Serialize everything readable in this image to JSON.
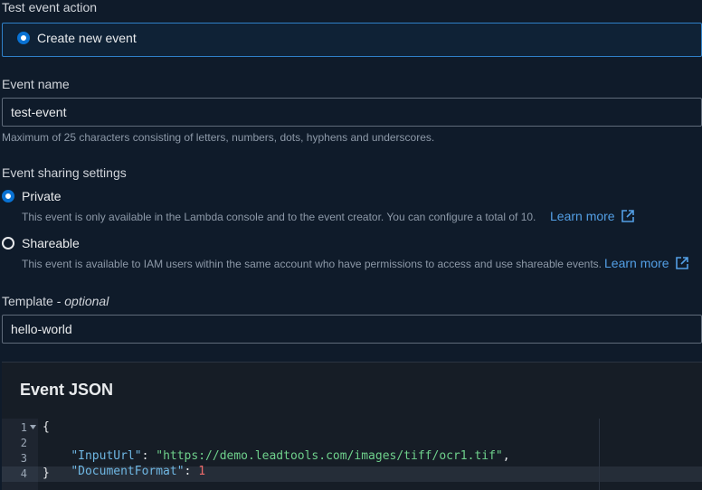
{
  "test_event_action": {
    "label": "Test event action",
    "option": "Create new event"
  },
  "event_name": {
    "label": "Event name",
    "value": "test-event",
    "help": "Maximum of 25 characters consisting of letters, numbers, dots, hyphens and underscores."
  },
  "sharing": {
    "label": "Event sharing settings",
    "private": {
      "label": "Private",
      "description": "This event is only available in the Lambda console and to the event creator. You can configure a total of 10.",
      "link": "Learn more"
    },
    "shareable": {
      "label": "Shareable",
      "description": "This event is available to IAM users within the same account who have permissions to access and use shareable events.",
      "link": "Learn more"
    }
  },
  "template": {
    "label": "Template",
    "optional": "optional",
    "value": "hello-world"
  },
  "event_json": {
    "title": "Event JSON",
    "lines": [
      {
        "num": "1",
        "open": "{"
      },
      {
        "num": "2",
        "key": "\"InputUrl\"",
        "value": "\"https://demo.leadtools.com/images/tiff/ocr1.tif\""
      },
      {
        "num": "3",
        "key": "\"DocumentFormat\"",
        "value": "1"
      },
      {
        "num": "4",
        "close": "}"
      }
    ]
  }
}
